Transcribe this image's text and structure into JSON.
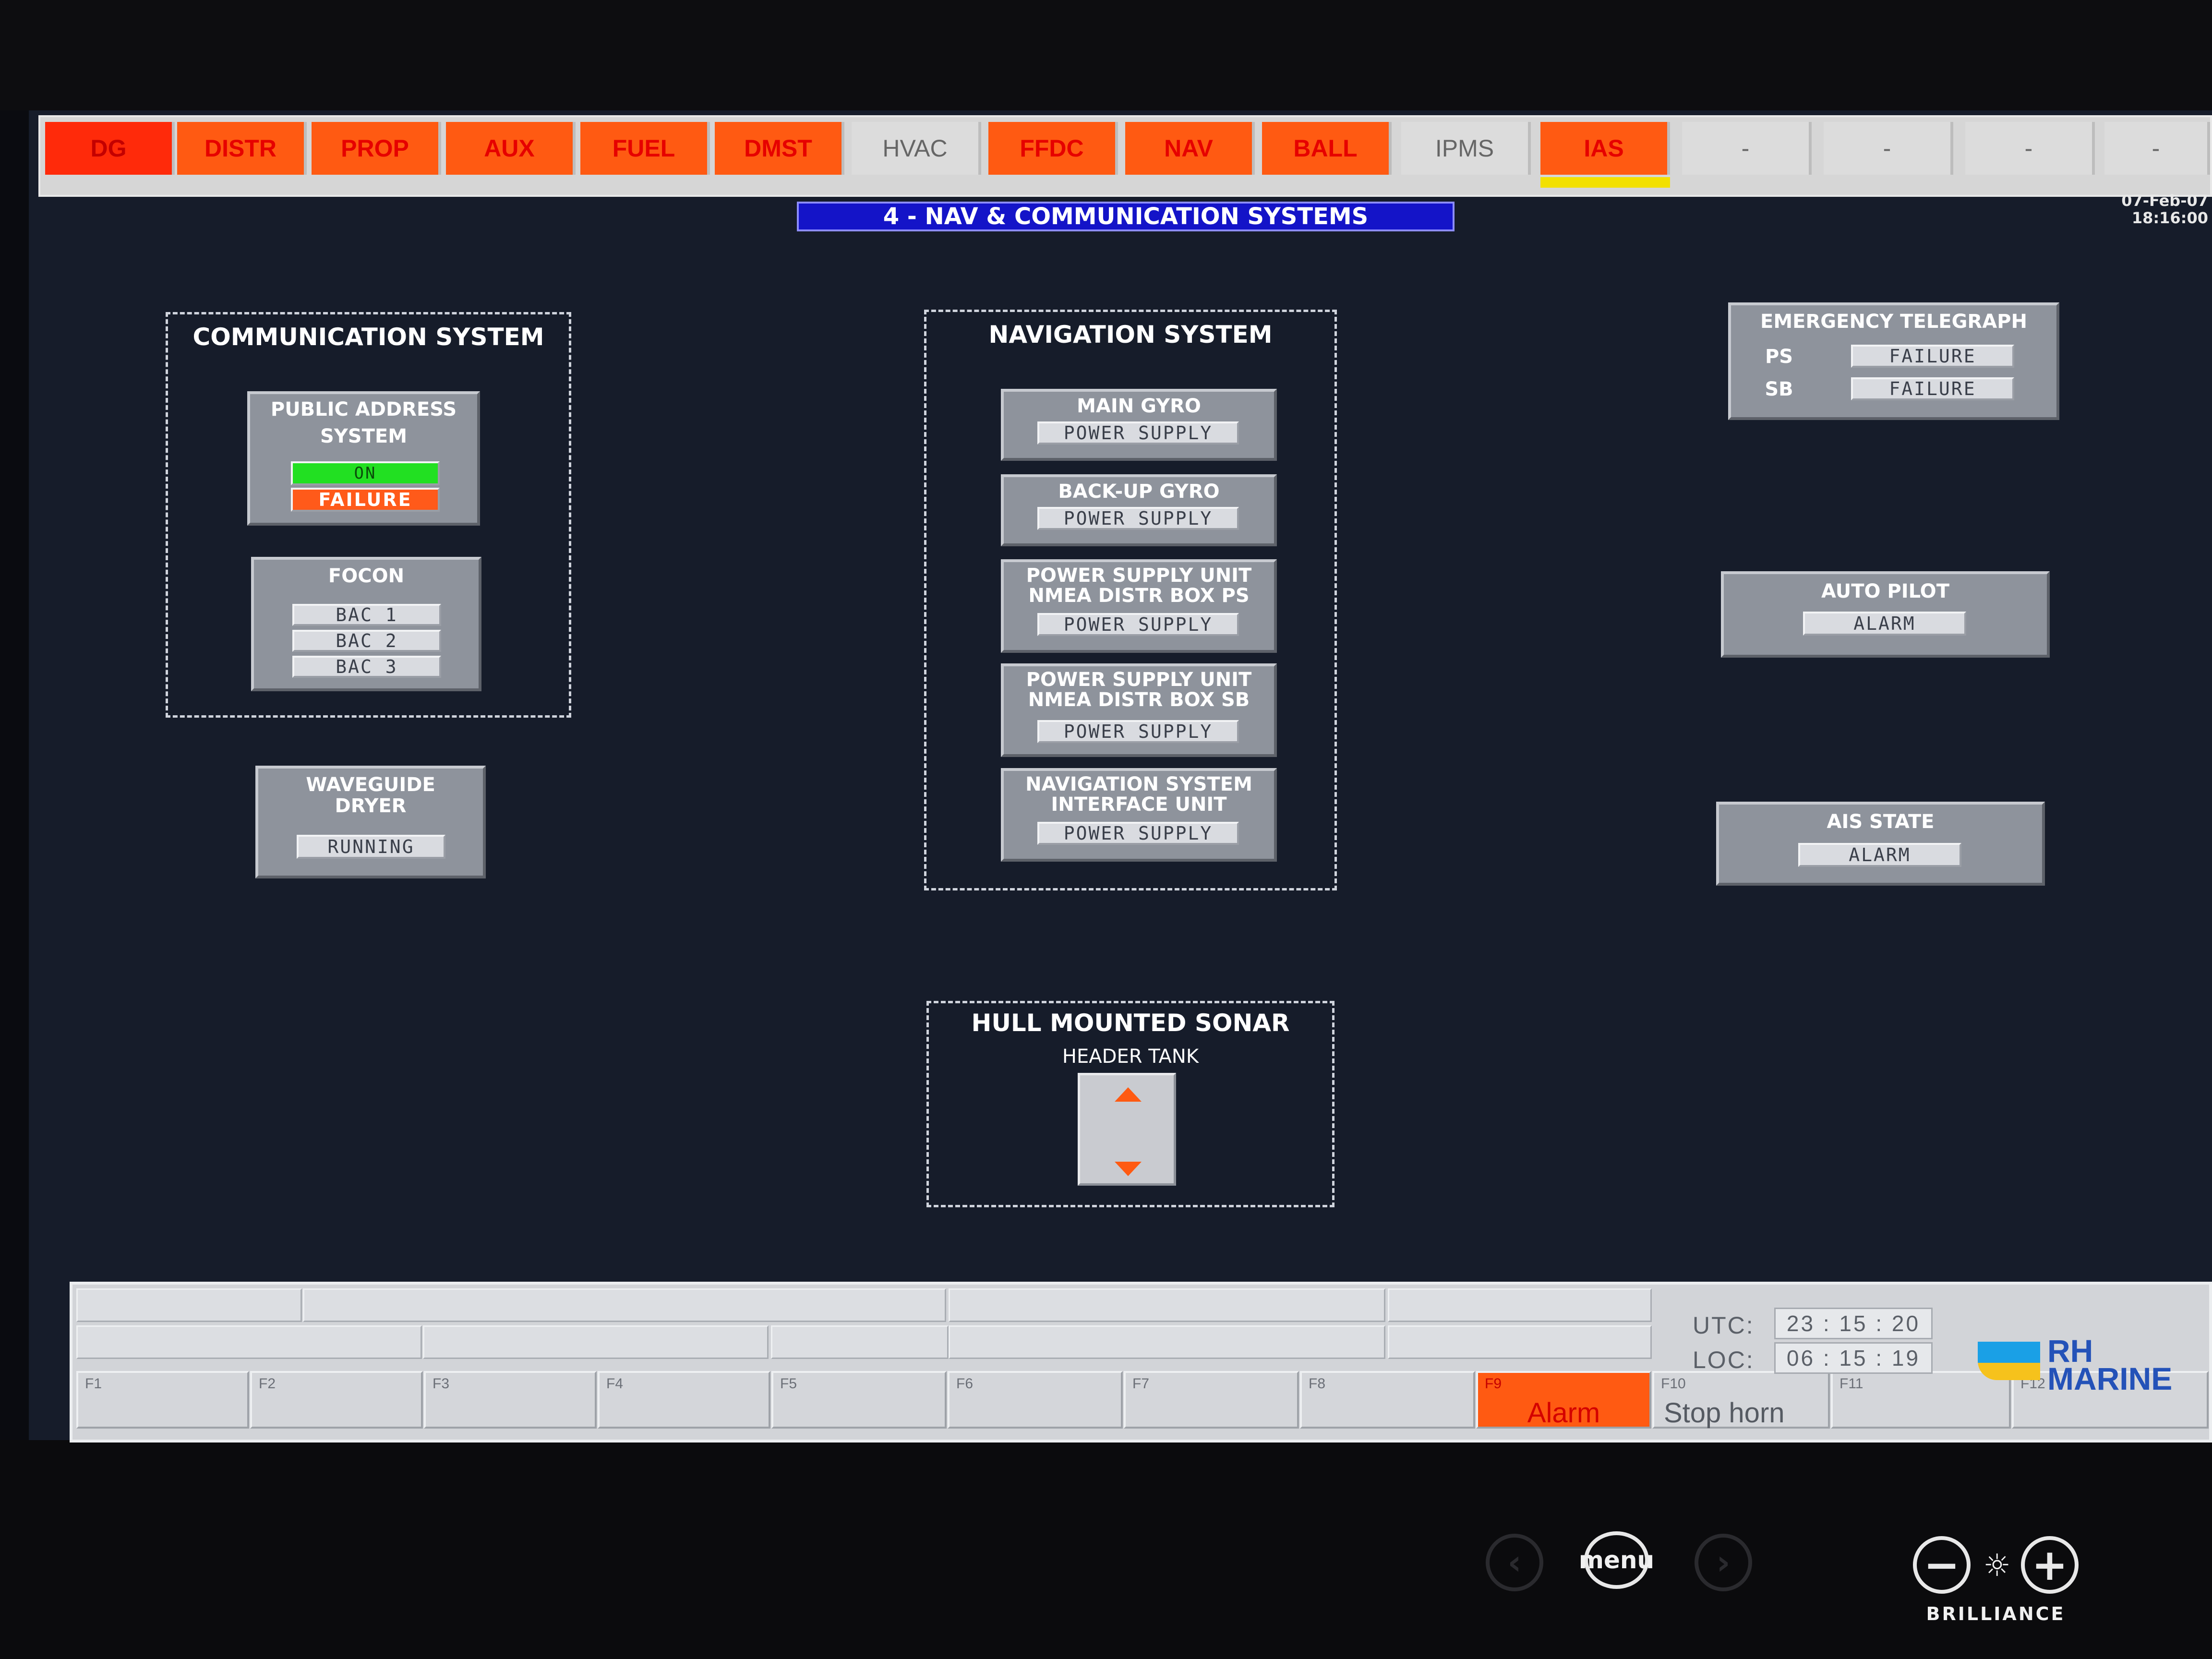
{
  "top_tabs": [
    {
      "label": "DG",
      "state": "alarm"
    },
    {
      "label": "DISTR",
      "state": "alarm"
    },
    {
      "label": "PROP",
      "state": "alarm"
    },
    {
      "label": "AUX",
      "state": "alarm"
    },
    {
      "label": "FUEL",
      "state": "alarm"
    },
    {
      "label": "DMST",
      "state": "alarm"
    },
    {
      "label": "HVAC",
      "state": "normal"
    },
    {
      "label": "FFDC",
      "state": "alarm"
    },
    {
      "label": "NAV",
      "state": "alarm"
    },
    {
      "label": "BALL",
      "state": "alarm"
    },
    {
      "label": "IPMS",
      "state": "normal"
    },
    {
      "label": "IAS",
      "state": "alarm"
    },
    {
      "label": "-",
      "state": "normal"
    },
    {
      "label": "-",
      "state": "normal"
    },
    {
      "label": "-",
      "state": "normal"
    },
    {
      "label": "-",
      "state": "normal"
    }
  ],
  "header": {
    "page_title": "4 - NAV & COMMUNICATION SYSTEMS",
    "date": "07-Feb-07",
    "time": "18:16:00"
  },
  "communication": {
    "title": "COMMUNICATION SYSTEM",
    "public_address": {
      "label_line1": "PUBLIC ADDRESS",
      "label_line2": "SYSTEM",
      "status_on": "ON",
      "status_failure": "FAILURE"
    },
    "focon": {
      "label": "FOCON",
      "items": [
        "BAC 1",
        "BAC 2",
        "BAC 3"
      ]
    }
  },
  "waveguide": {
    "label_line1": "WAVEGUIDE",
    "label_line2": "DRYER",
    "status": "RUNNING"
  },
  "navigation": {
    "title": "NAVIGATION SYSTEM",
    "units": [
      {
        "line1": "MAIN GYRO",
        "line2": "",
        "status": "POWER SUPPLY"
      },
      {
        "line1": "BACK-UP GYRO",
        "line2": "",
        "status": "POWER SUPPLY"
      },
      {
        "line1": "POWER SUPPLY UNIT",
        "line2": "NMEA DISTR BOX PS",
        "status": "POWER SUPPLY"
      },
      {
        "line1": "POWER SUPPLY UNIT",
        "line2": "NMEA DISTR BOX SB",
        "status": "POWER SUPPLY"
      },
      {
        "line1": "NAVIGATION SYSTEM",
        "line2": "INTERFACE UNIT",
        "status": "POWER SUPPLY"
      }
    ]
  },
  "sonar": {
    "title": "HULL MOUNTED SONAR",
    "subtitle": "HEADER TANK"
  },
  "emergency_telegraph": {
    "title": "EMERGENCY TELEGRAPH",
    "ps_label": "PS",
    "ps_status": "FAILURE",
    "sb_label": "SB",
    "sb_status": "FAILURE"
  },
  "auto_pilot": {
    "title": "AUTO PILOT",
    "status": "ALARM"
  },
  "ais_state": {
    "title": "AIS STATE",
    "status": "ALARM"
  },
  "function_keys": [
    {
      "key": "F1",
      "label": ""
    },
    {
      "key": "F2",
      "label": ""
    },
    {
      "key": "F3",
      "label": ""
    },
    {
      "key": "F4",
      "label": ""
    },
    {
      "key": "F5",
      "label": ""
    },
    {
      "key": "F6",
      "label": ""
    },
    {
      "key": "F7",
      "label": ""
    },
    {
      "key": "F8",
      "label": ""
    },
    {
      "key": "F9",
      "label": "Alarm"
    },
    {
      "key": "F10",
      "label": "Stop horn"
    },
    {
      "key": "F11",
      "label": ""
    },
    {
      "key": "F12",
      "label": ""
    }
  ],
  "clock": {
    "utc_label": "UTC:",
    "utc_value": "23 : 15 : 20",
    "loc_label": "LOC:",
    "loc_value": "06 : 15 : 19"
  },
  "logo": {
    "line1": "RH",
    "line2": "MARINE"
  },
  "hardware": {
    "menu_label": "menu",
    "brilliance_label": "BRILLIANCE"
  },
  "colors": {
    "alarm_tab": "#ff5a12",
    "alarm_text": "#e60000",
    "title_bar": "#1414c8",
    "status_on": "#22e022",
    "status_failure": "#ff5a1a",
    "screen_bg": "#161c2a"
  }
}
